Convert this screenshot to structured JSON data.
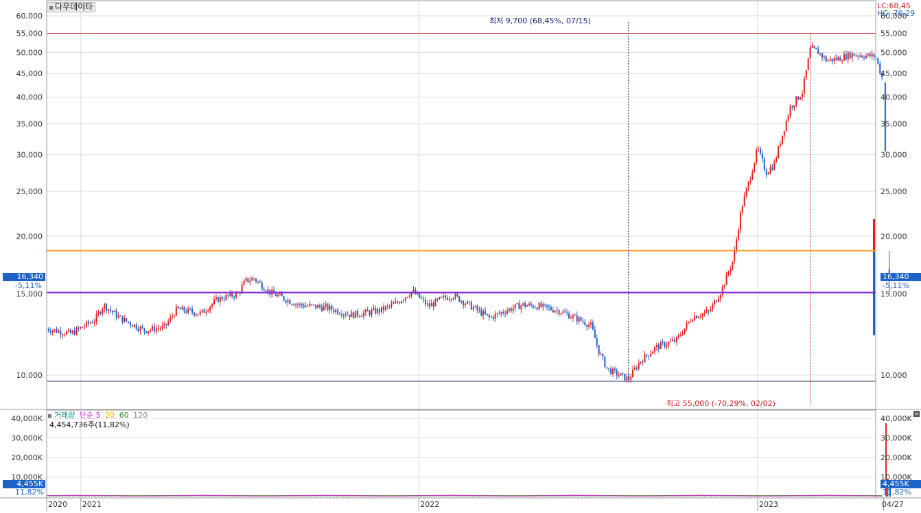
{
  "stock_name": "다우데이타",
  "lc_text": "LC:68,45",
  "hc_text": "HC:-70,29",
  "current_price_label": "16,340",
  "current_change_label": "-5,11%",
  "low_annotation": "최저 9,700 (68,45%, 07/15)",
  "high_annotation": "최고 55,000 (-70,29%, 02/02)",
  "volume_panel": {
    "title": "거래량",
    "ma_label": "단순",
    "ma_periods": [
      "5",
      "20",
      "60",
      "120"
    ],
    "last_volume_text": "4,454,736주(11,82%)",
    "current_volume_label": "4,455K",
    "current_volume_pct": "11,82%"
  },
  "colors": {
    "up": "#e0201e",
    "down": "#1a5fcc",
    "grid": "#dcdcdc",
    "orange_line": "#ff9d1e",
    "purple_line": "#8a2be2",
    "high_line": "#c81a1a",
    "low_line": "#1a1a5c",
    "ma5": "#d633d6",
    "ma20": "#f0b400",
    "ma60": "#2f8f2f",
    "ma120": "#8a8a8a"
  },
  "chart_data": [
    {
      "type": "line",
      "subtype": "candlestick",
      "scale": "log",
      "y_ticks": [
        10000,
        15000,
        20000,
        25000,
        30000,
        35000,
        40000,
        45000,
        50000,
        55000,
        60000
      ],
      "y_tick_labels": [
        "10,000",
        "15,000",
        "20,000",
        "25,000",
        "30,000",
        "35,000",
        "40,000",
        "45,000",
        "50,000",
        "55,000",
        "60,000"
      ],
      "x_tick_labels": [
        "2020",
        "2021",
        "2022",
        "2023",
        "04/27"
      ],
      "reference_lines": [
        {
          "value": 55000,
          "color_key": "high_line"
        },
        {
          "value": 18600,
          "color_key": "orange_line"
        },
        {
          "value": 15100,
          "color_key": "purple_line"
        },
        {
          "value": 9700,
          "color_key": "low_line"
        }
      ],
      "current_price": 16340,
      "low": {
        "value": 9700,
        "date": "07/15"
      },
      "high": {
        "value": 55000,
        "date": "02/02"
      },
      "approx_close_path": [
        {
          "t": 0.0,
          "v": 12600
        },
        {
          "t": 0.03,
          "v": 12300
        },
        {
          "t": 0.06,
          "v": 13200
        },
        {
          "t": 0.07,
          "v": 14200
        },
        {
          "t": 0.09,
          "v": 13300
        },
        {
          "t": 0.12,
          "v": 12500
        },
        {
          "t": 0.145,
          "v": 12700
        },
        {
          "t": 0.16,
          "v": 13900
        },
        {
          "t": 0.19,
          "v": 13600
        },
        {
          "t": 0.21,
          "v": 14600
        },
        {
          "t": 0.235,
          "v": 15000
        },
        {
          "t": 0.245,
          "v": 16000
        },
        {
          "t": 0.255,
          "v": 16200
        },
        {
          "t": 0.275,
          "v": 15100
        },
        {
          "t": 0.31,
          "v": 14200
        },
        {
          "t": 0.345,
          "v": 14000
        },
        {
          "t": 0.375,
          "v": 13500
        },
        {
          "t": 0.41,
          "v": 13800
        },
        {
          "t": 0.43,
          "v": 14300
        },
        {
          "t": 0.45,
          "v": 15200
        },
        {
          "t": 0.47,
          "v": 14100
        },
        {
          "t": 0.485,
          "v": 14600
        },
        {
          "t": 0.5,
          "v": 14900
        },
        {
          "t": 0.525,
          "v": 14000
        },
        {
          "t": 0.545,
          "v": 13300
        },
        {
          "t": 0.565,
          "v": 13800
        },
        {
          "t": 0.585,
          "v": 14200
        },
        {
          "t": 0.605,
          "v": 14100
        },
        {
          "t": 0.63,
          "v": 13800
        },
        {
          "t": 0.655,
          "v": 13200
        },
        {
          "t": 0.67,
          "v": 12800
        },
        {
          "t": 0.68,
          "v": 11200
        },
        {
          "t": 0.69,
          "v": 10300
        },
        {
          "t": 0.705,
          "v": 10000
        },
        {
          "t": 0.716,
          "v": 9800
        },
        {
          "t": 0.73,
          "v": 10700
        },
        {
          "t": 0.75,
          "v": 11500
        },
        {
          "t": 0.775,
          "v": 11900
        },
        {
          "t": 0.795,
          "v": 13400
        },
        {
          "t": 0.815,
          "v": 13700
        },
        {
          "t": 0.83,
          "v": 15200
        },
        {
          "t": 0.845,
          "v": 17800
        },
        {
          "t": 0.855,
          "v": 23000
        },
        {
          "t": 0.865,
          "v": 26500
        },
        {
          "t": 0.875,
          "v": 31000
        },
        {
          "t": 0.885,
          "v": 27500
        },
        {
          "t": 0.895,
          "v": 28500
        },
        {
          "t": 0.905,
          "v": 33000
        },
        {
          "t": 0.915,
          "v": 38000
        },
        {
          "t": 0.93,
          "v": 41000
        },
        {
          "t": 0.94,
          "v": 51000
        },
        {
          "t": 0.95,
          "v": 50000
        },
        {
          "t": 0.96,
          "v": 48000
        },
        {
          "t": 0.975,
          "v": 48500
        },
        {
          "t": 0.99,
          "v": 49500
        },
        {
          "t": 1.02,
          "v": 49000
        },
        {
          "t": 1.03,
          "v": 43000
        },
        {
          "t": 1.032,
          "v": 31000
        },
        {
          "t": 1.035,
          "v": 17500
        },
        {
          "t": 1.038,
          "v": 16340
        }
      ]
    },
    {
      "type": "bar",
      "name": "거래량",
      "y_ticks": [
        10000,
        20000,
        30000,
        40000
      ],
      "y_tick_labels": [
        "10,000K",
        "20,000K",
        "30,000K",
        "40,000K"
      ],
      "current_value": 4455,
      "approx_spikes": [
        {
          "t": 1.033,
          "v": 37500
        },
        {
          "t": 1.035,
          "v": 9000
        },
        {
          "t": 1.038,
          "v": 4455
        }
      ]
    }
  ]
}
